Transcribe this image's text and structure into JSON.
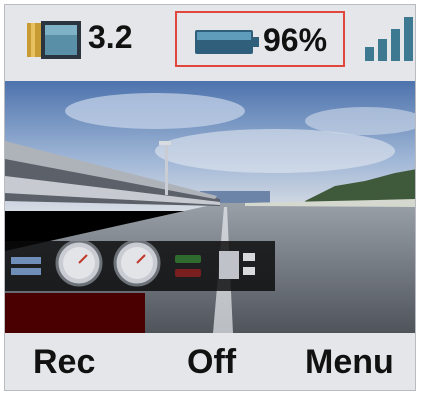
{
  "status": {
    "storage_value": "3.2",
    "battery_percent_text": "96%",
    "battery_level": 0.96,
    "signal_bars_filled": 4,
    "highlight_color": "#e0463c",
    "icons": {
      "storage": "storage-card-icon",
      "battery": "battery-icon",
      "signal": "signal-strength-icon"
    }
  },
  "video": {
    "description_icon": "camera-feed",
    "hud": {
      "gauges": 2
    }
  },
  "softkeys": {
    "left_label": "Rec",
    "center_label": "Off",
    "right_label": "Menu"
  }
}
